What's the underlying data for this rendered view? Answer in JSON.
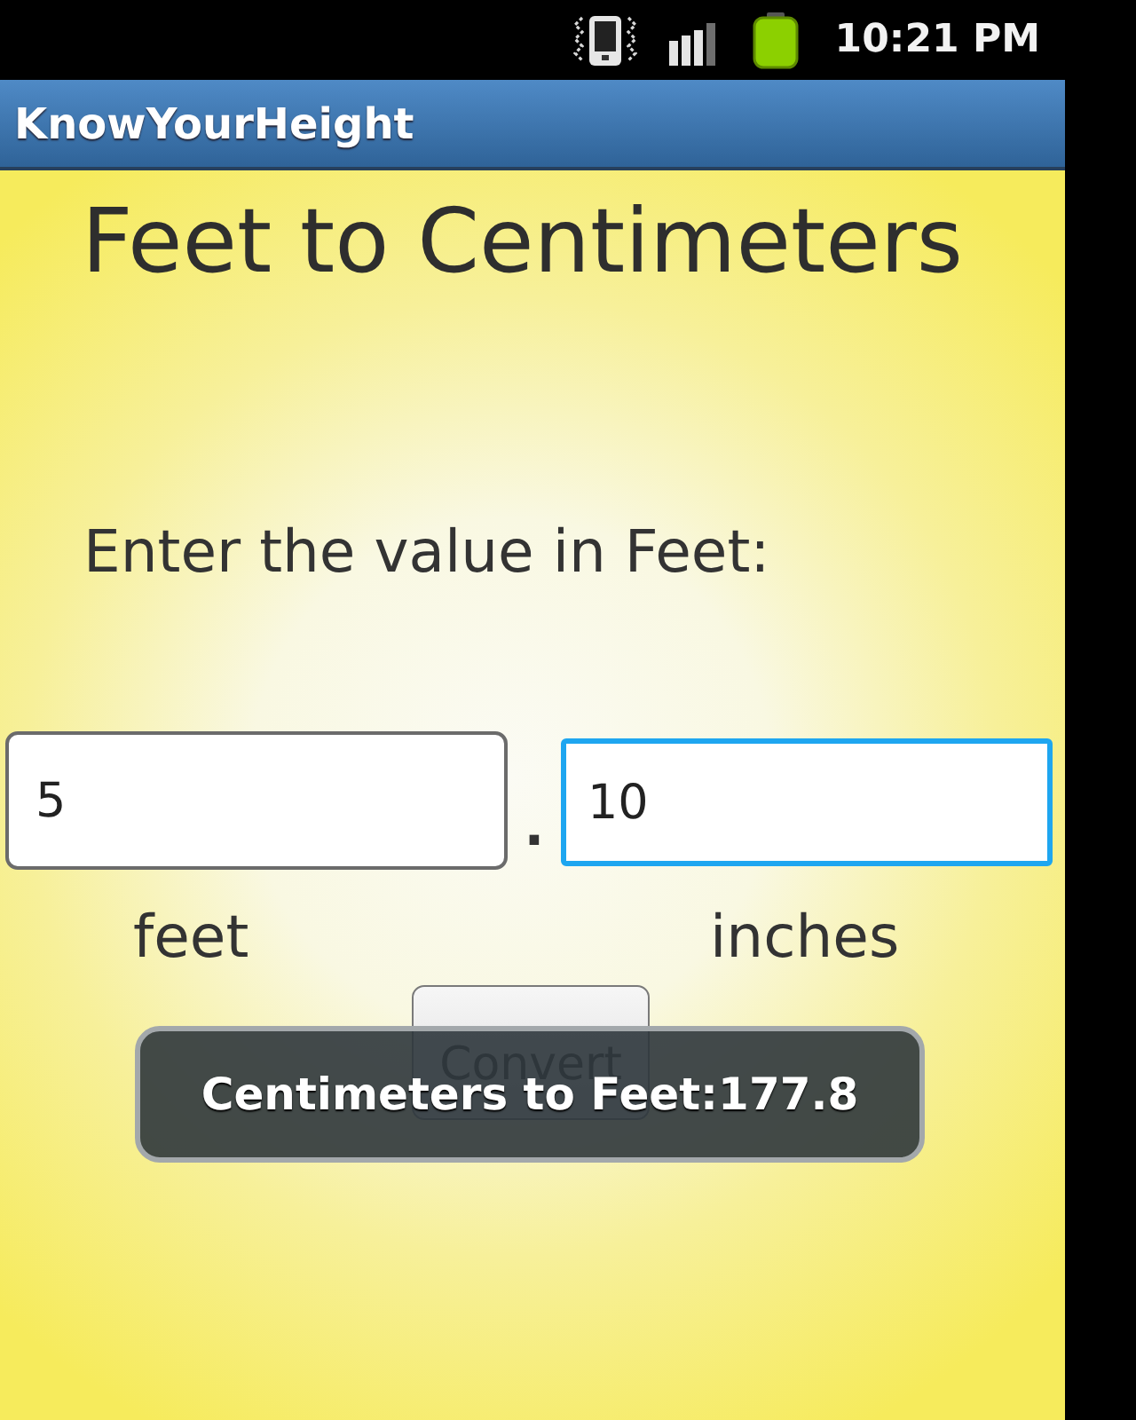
{
  "status_bar": {
    "time": "10:21 PM"
  },
  "app_bar": {
    "title": "KnowYourHeight"
  },
  "heading": "Feet to Centimeters",
  "prompt": "Enter the value in Feet:",
  "fields": [
    {
      "value": "5",
      "unit": "feet",
      "focused": false
    },
    {
      "value": "10",
      "unit": "inches",
      "focused": true
    }
  ],
  "separator": ".",
  "button": {
    "label": "Convert"
  },
  "toast": {
    "text": "Centimeters to Feet:177.8"
  }
}
